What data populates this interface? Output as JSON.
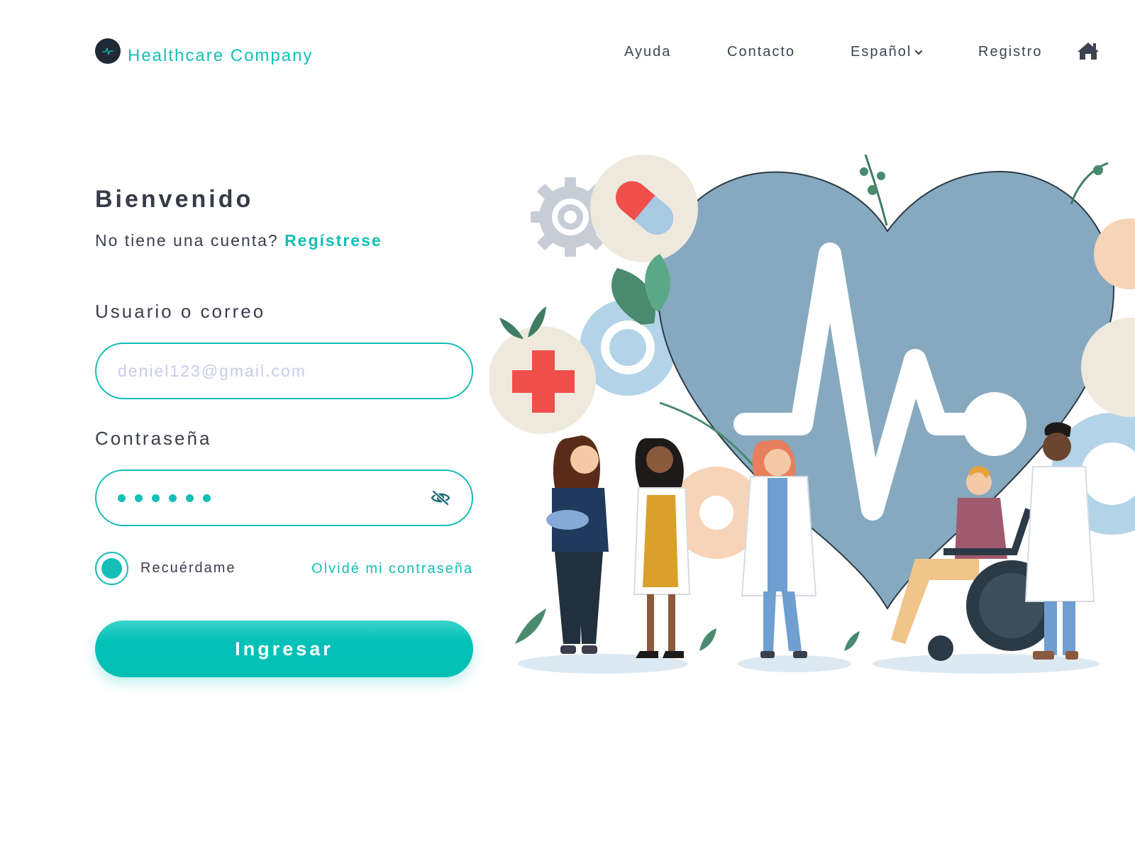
{
  "brand": {
    "name": "Healthcare Company",
    "logo_icon": "pulse-logo-icon"
  },
  "nav": {
    "items": [
      {
        "label": "Ayuda"
      },
      {
        "label": "Contacto"
      },
      {
        "label": "Español",
        "icon": "chevron-down-icon"
      },
      {
        "label": "Registro"
      }
    ],
    "home_icon": "home-icon"
  },
  "login": {
    "title": "Bienvenido",
    "signup_prompt": "No tiene una cuenta?",
    "signup_link": "Regístrese",
    "username_label": "Usuario o correo",
    "username_placeholder": "deniel123@gmail.com",
    "password_label": "Contraseña",
    "password_masked_length": 6,
    "password_toggle_icon": "eye-off-icon",
    "remember_label": "Recuérdame",
    "remember_checked": true,
    "forgot_link": "Olvidé mi contraseña",
    "submit_label": "Ingresar"
  },
  "colors": {
    "accent": "#13bfb6",
    "text": "#3a3f4b",
    "placeholder": "#c9cbe8",
    "heart": "#86a9bf"
  }
}
